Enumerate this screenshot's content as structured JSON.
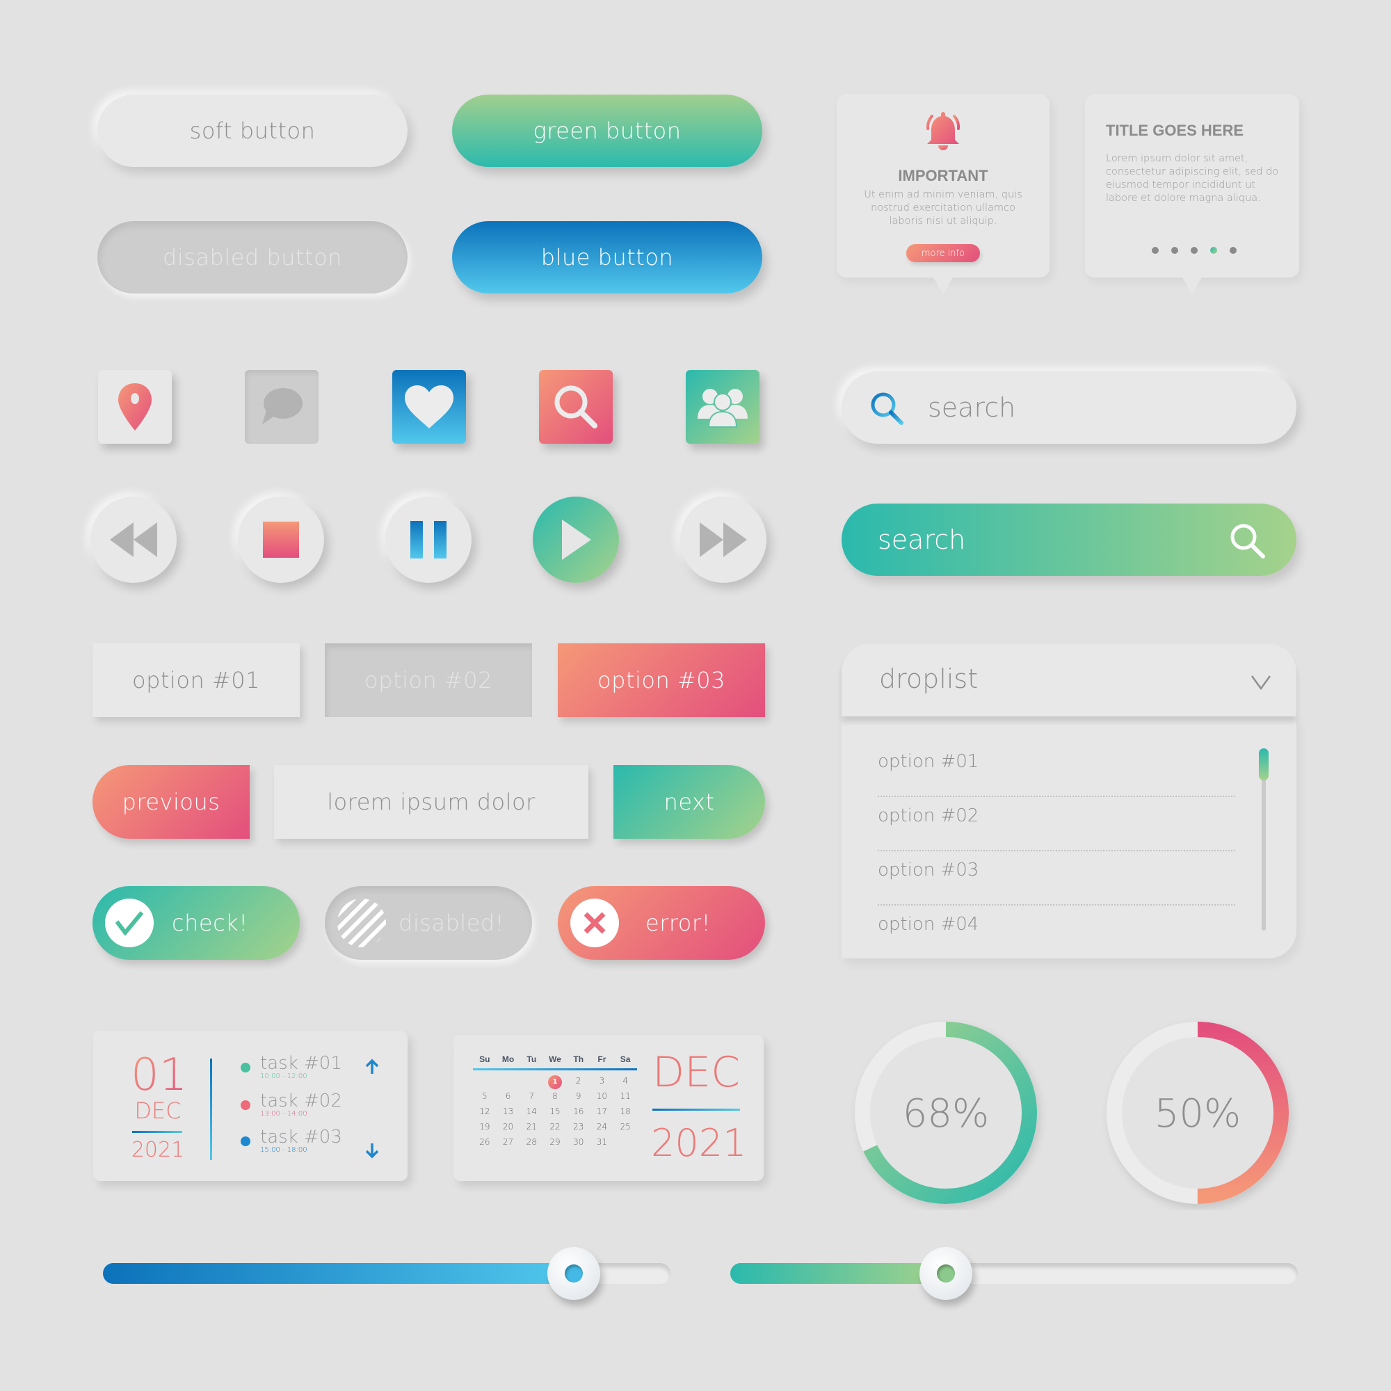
{
  "buttons": {
    "soft": "soft button",
    "green": "green button",
    "disabled": "disabled button",
    "blue": "blue button"
  },
  "notification_card": {
    "icon": "bell-icon",
    "title": "IMPORTANT",
    "body": "Ut enim ad minim veniam, quis nostrud exercitation ullamco laboris nisi ut aliquip.",
    "button": "more info"
  },
  "info_card": {
    "title": "TITLE GOES HERE",
    "body": "Lorem ipsum dolor sit amet, consectetur adipiscing elit, sed do eiusmod tempor incididunt ut labore et dolore magna aliqua.",
    "pagination": {
      "total": 5,
      "active_index": 3
    }
  },
  "icon_tiles": [
    "map-pin-icon",
    "chat-bubble-icon",
    "heart-icon",
    "search-icon",
    "users-icon"
  ],
  "media_controls": [
    "rewind-icon",
    "stop-icon",
    "pause-icon",
    "play-icon",
    "fast-forward-icon"
  ],
  "search_soft": {
    "placeholder": "search",
    "icon": "search-icon"
  },
  "search_green": {
    "placeholder": "search",
    "icon": "search-icon"
  },
  "options": [
    "option #01",
    "option #02",
    "option #03"
  ],
  "pager": {
    "previous": "previous",
    "middle": "lorem ipsum dolor",
    "next": "next"
  },
  "status": {
    "check": "check!",
    "disabled": "disabled!",
    "error": "error!"
  },
  "droplist": {
    "label": "droplist",
    "items": [
      "option #01",
      "option #02",
      "option #03",
      "option #04"
    ]
  },
  "date_card": {
    "day": "01",
    "month": "DEC",
    "year": "2021",
    "tasks": [
      {
        "name": "task #01",
        "time": "10:00 - 12:00",
        "color": "#4cbf9e"
      },
      {
        "name": "task #02",
        "time": "13:00 - 14:00",
        "color": "#ec6a7a"
      },
      {
        "name": "task #03",
        "time": "15:00 - 18:00",
        "color": "#1e88cf"
      }
    ]
  },
  "calendar": {
    "weekdays": [
      "Su",
      "Mo",
      "Tu",
      "We",
      "Th",
      "Fr",
      "Sa"
    ],
    "rows": [
      [
        "",
        "",
        "",
        "1",
        "2",
        "3",
        "4"
      ],
      [
        "5",
        "6",
        "7",
        "8",
        "9",
        "10",
        "11"
      ],
      [
        "12",
        "13",
        "14",
        "15",
        "16",
        "17",
        "18"
      ],
      [
        "19",
        "20",
        "21",
        "22",
        "23",
        "24",
        "25"
      ],
      [
        "26",
        "27",
        "28",
        "29",
        "30",
        "31",
        ""
      ]
    ],
    "selected": "1",
    "month": "DEC",
    "year": "2021"
  },
  "progress_rings": [
    {
      "label": "68%",
      "value": 0.68
    },
    {
      "label": "50%",
      "value": 0.5
    }
  ],
  "sliders": [
    {
      "value": 0.83,
      "style": "blue"
    },
    {
      "value": 0.38,
      "style": "green"
    }
  ],
  "colors": {
    "background": "#e2e2e2",
    "green_start": "#2bb9ad",
    "green_end": "#a5d28b",
    "blue_start": "#0c72bb",
    "blue_end": "#52c8ec",
    "red_start": "#f59878",
    "red_end": "#e34f7d"
  }
}
